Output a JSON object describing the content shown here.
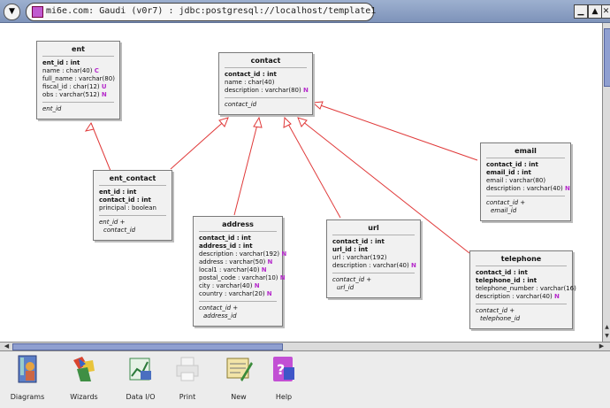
{
  "window": {
    "title": "mi6e.com: Gaudi (v0r7) : jdbc:postgresql://localhost/template1",
    "buttons": [
      "minimize",
      "maximize",
      "close"
    ]
  },
  "entities": {
    "ent": {
      "name": "ent",
      "attrs": [
        {
          "text": "ent_id : int",
          "pk": true,
          "flag": ""
        },
        {
          "text": "name : char(40)",
          "pk": false,
          "flag": "C"
        },
        {
          "text": "full_name : varchar(80)",
          "pk": false,
          "flag": ""
        },
        {
          "text": "fiscal_id : char(12)",
          "pk": false,
          "flag": "U"
        },
        {
          "text": "obs : varchar(512)",
          "pk": false,
          "flag": "N"
        }
      ],
      "keys": [
        "ent_id"
      ]
    },
    "contact": {
      "name": "contact",
      "attrs": [
        {
          "text": "contact_id : int",
          "pk": true,
          "flag": ""
        },
        {
          "text": "name : char(40)",
          "pk": false,
          "flag": ""
        },
        {
          "text": "description : varchar(80)",
          "pk": false,
          "flag": "N"
        }
      ],
      "keys": [
        "contact_id"
      ]
    },
    "ent_contact": {
      "name": "ent_contact",
      "attrs": [
        {
          "text": "ent_id : int",
          "pk": true,
          "flag": ""
        },
        {
          "text": "contact_id : int",
          "pk": true,
          "flag": ""
        },
        {
          "text": "principal : boolean",
          "pk": false,
          "flag": ""
        }
      ],
      "keys": [
        "ent_id +",
        "contact_id"
      ]
    },
    "address": {
      "name": "address",
      "attrs": [
        {
          "text": "contact_id : int",
          "pk": true,
          "flag": ""
        },
        {
          "text": "address_id : int",
          "pk": true,
          "flag": ""
        },
        {
          "text": "description : varchar(192)",
          "pk": false,
          "flag": "N"
        },
        {
          "text": "address : varchar(50)",
          "pk": false,
          "flag": "N"
        },
        {
          "text": "local1 : varchar(40)",
          "pk": false,
          "flag": "N"
        },
        {
          "text": "postal_code : varchar(10)",
          "pk": false,
          "flag": "N"
        },
        {
          "text": "city : varchar(40)",
          "pk": false,
          "flag": "N"
        },
        {
          "text": "country : varchar(20)",
          "pk": false,
          "flag": "N"
        }
      ],
      "keys": [
        "contact_id +",
        "address_id"
      ]
    },
    "url": {
      "name": "url",
      "attrs": [
        {
          "text": "contact_id : int",
          "pk": true,
          "flag": ""
        },
        {
          "text": "url_id : int",
          "pk": true,
          "flag": ""
        },
        {
          "text": "url : varchar(192)",
          "pk": false,
          "flag": ""
        },
        {
          "text": "description : varchar(40)",
          "pk": false,
          "flag": "N"
        }
      ],
      "keys": [
        "contact_id +",
        "url_id"
      ]
    },
    "email": {
      "name": "email",
      "attrs": [
        {
          "text": "contact_id : int",
          "pk": true,
          "flag": ""
        },
        {
          "text": "email_id : int",
          "pk": true,
          "flag": ""
        },
        {
          "text": "email : varchar(80)",
          "pk": false,
          "flag": ""
        },
        {
          "text": "description : varchar(40)",
          "pk": false,
          "flag": "N"
        }
      ],
      "keys": [
        "contact_id +",
        "email_id"
      ]
    },
    "telephone": {
      "name": "telephone",
      "attrs": [
        {
          "text": "contact_id : int",
          "pk": true,
          "flag": ""
        },
        {
          "text": "telephone_id : int",
          "pk": true,
          "flag": ""
        },
        {
          "text": "telephone_number : varchar(16)",
          "pk": false,
          "flag": ""
        },
        {
          "text": "description : varchar(40)",
          "pk": false,
          "flag": "N"
        }
      ],
      "keys": [
        "contact_id +",
        "telephone_id"
      ]
    }
  },
  "relations": [
    {
      "from": "ent_contact",
      "to": "ent"
    },
    {
      "from": "ent_contact",
      "to": "contact"
    },
    {
      "from": "address",
      "to": "contact"
    },
    {
      "from": "url",
      "to": "contact"
    },
    {
      "from": "email",
      "to": "contact"
    },
    {
      "from": "telephone",
      "to": "contact"
    }
  ],
  "toolbar": {
    "items": [
      {
        "label": "Diagrams",
        "icon": "diagrams-icon"
      },
      {
        "label": "Wizards",
        "icon": "wizards-icon"
      },
      {
        "label": "Data I/O",
        "icon": "data-io-icon"
      },
      {
        "label": "Print",
        "icon": "print-icon"
      },
      {
        "label": "New",
        "icon": "new-icon"
      },
      {
        "label": "Help",
        "icon": "help-icon"
      }
    ]
  },
  "colors": {
    "relation_line": "#e03a3a",
    "null_flag": "#b52acb",
    "scroll_thumb": "#8f9fd0",
    "titlebar": "#8aa0c6"
  }
}
